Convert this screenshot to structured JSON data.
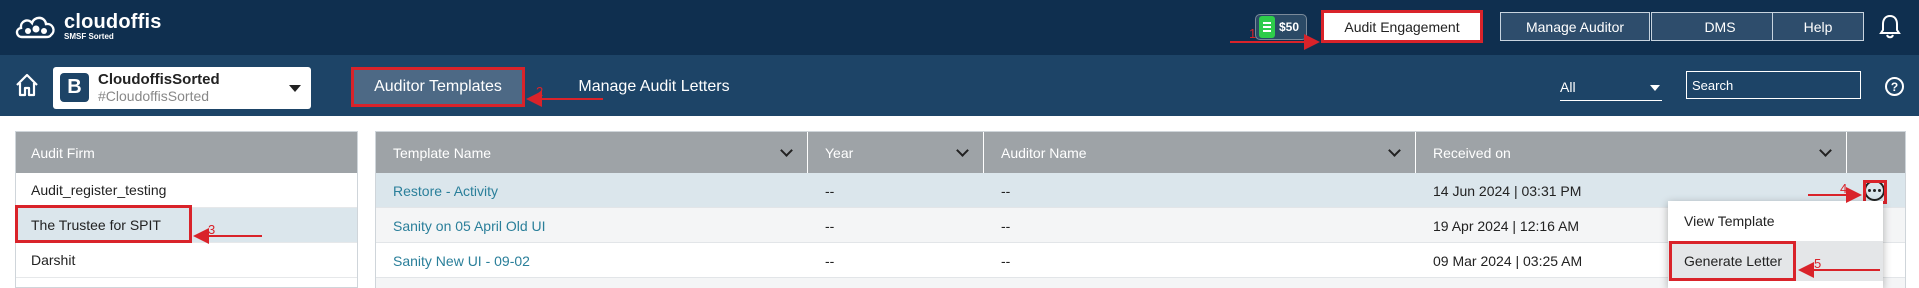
{
  "app": {
    "brand_name": "cloudoffis",
    "brand_sub": "SMSF Sorted"
  },
  "topbar": {
    "wallet_value": "$50",
    "buttons": [
      "Audit Engagement",
      "Manage Auditor",
      "DMS",
      "Help"
    ]
  },
  "subbar": {
    "company_initial": "B",
    "company_name": "CloudoffisSorted",
    "company_code": "#CloudoffisSorted",
    "tabs": [
      "Auditor Templates",
      "Manage Audit Letters"
    ],
    "filter_value": "All",
    "search_placeholder": "Search"
  },
  "left_panel": {
    "header": "Audit Firm",
    "items": [
      "Audit_register_testing",
      "The Trustee for SPIT",
      "Darshit"
    ]
  },
  "table": {
    "columns": [
      "Template Name",
      "Year",
      "Auditor Name",
      "Received on"
    ],
    "rows": [
      {
        "name": "Restore - Activity",
        "year": "--",
        "auditor": "--",
        "received": "14 Jun 2024 | 03:31 PM"
      },
      {
        "name": "Sanity on 05 April Old UI",
        "year": "--",
        "auditor": "--",
        "received": "19 Apr 2024 | 12:16 AM"
      },
      {
        "name": "Sanity New UI - 09-02",
        "year": "--",
        "auditor": "--",
        "received": "09 Mar 2024 | 03:25 AM"
      }
    ]
  },
  "row_menu": {
    "items": [
      "View Template",
      "Generate Letter"
    ]
  },
  "annotations": {
    "step_numbers": [
      "1",
      "2",
      "3",
      "4",
      "5"
    ],
    "color": "#d9232a"
  },
  "colors": {
    "topbar_bg": "#0f2f4f",
    "subbar_bg": "#1d4467",
    "header_gray": "#9ea3a7",
    "selected_row": "#dbe6ec",
    "link": "#2a7f9a"
  }
}
